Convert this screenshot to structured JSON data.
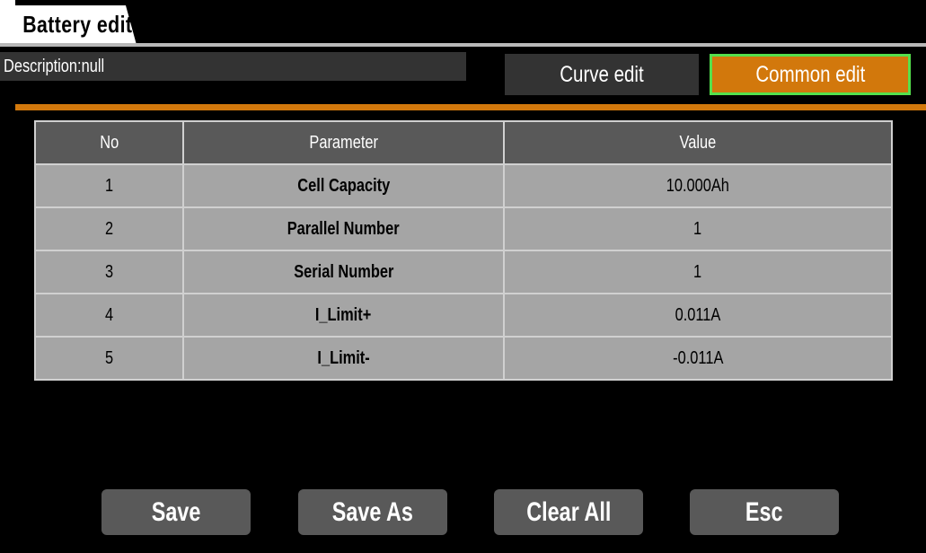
{
  "header": {
    "title": "Battery edit"
  },
  "description": {
    "text": "Description:null"
  },
  "mode_buttons": {
    "curve_edit": "Curve edit",
    "common_edit": "Common edit"
  },
  "table": {
    "columns": [
      "No",
      "Parameter",
      "Value"
    ],
    "rows": [
      {
        "no": "1",
        "parameter": "Cell Capacity",
        "value": "10.000Ah"
      },
      {
        "no": "2",
        "parameter": "Parallel Number",
        "value": "1"
      },
      {
        "no": "3",
        "parameter": "Serial Number",
        "value": "1"
      },
      {
        "no": "4",
        "parameter": "I_Limit+",
        "value": "0.011A"
      },
      {
        "no": "5",
        "parameter": "I_Limit-",
        "value": "-0.011A"
      }
    ]
  },
  "actions": {
    "save": "Save",
    "save_as": "Save As",
    "clear_all": "Clear All",
    "esc": "Esc"
  },
  "colors": {
    "accent": "#d2780c",
    "selected_border": "#55e04c",
    "header_cell": "#595959",
    "body_cell": "#a5a5a5",
    "background": "#000000"
  }
}
